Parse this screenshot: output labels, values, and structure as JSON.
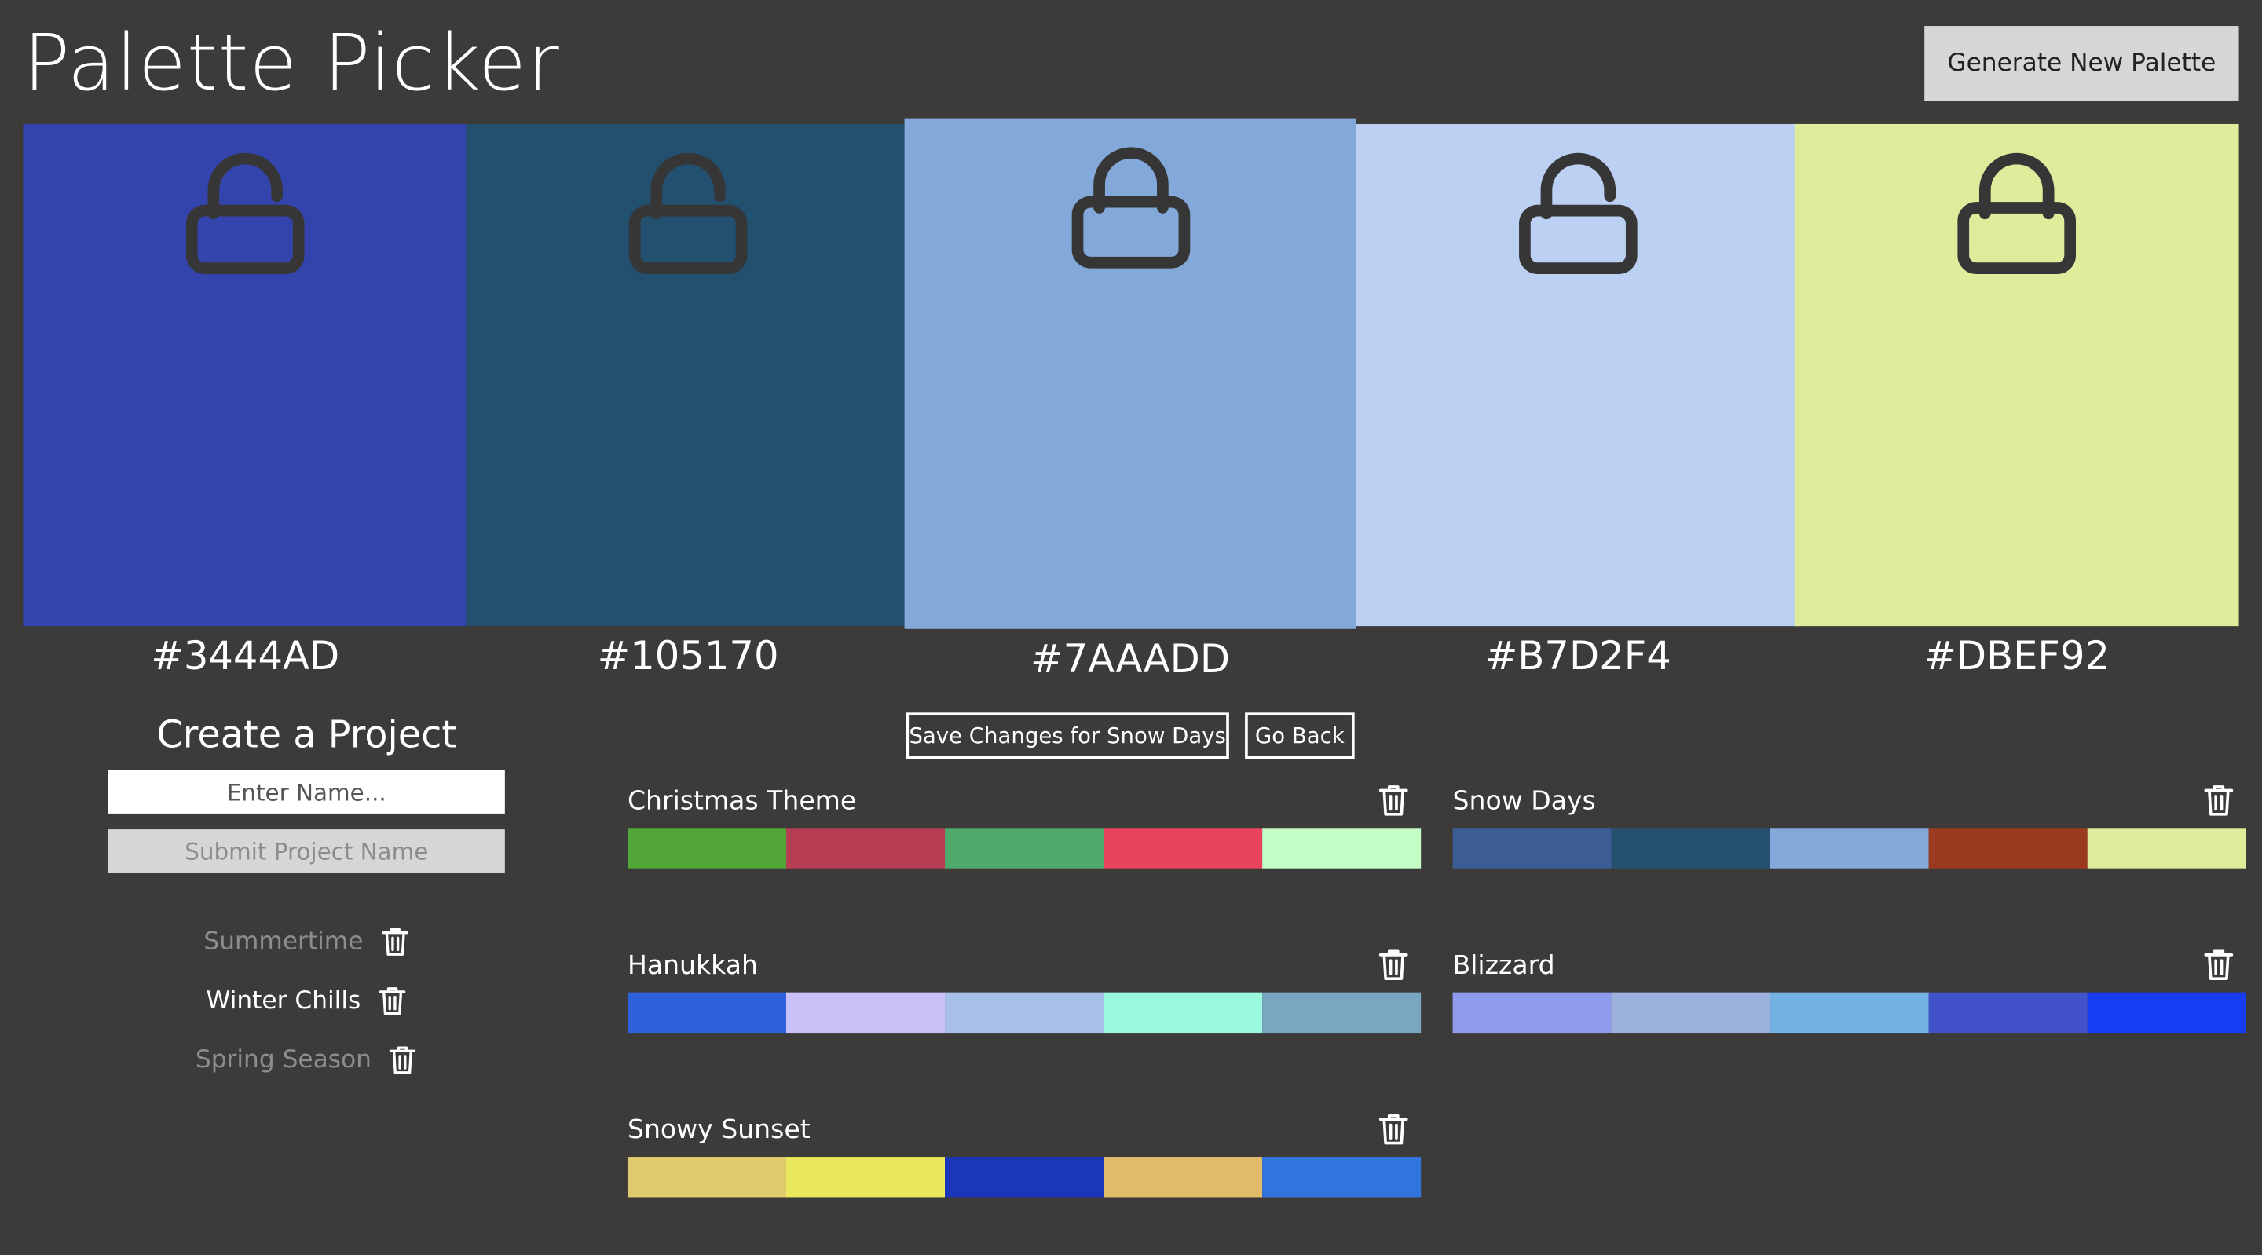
{
  "app": {
    "title": "Palette Picker",
    "generate_label": "Generate New Palette"
  },
  "swatches": [
    {
      "hex": "#3444AD",
      "color": "#3444AD",
      "locked": false
    },
    {
      "hex": "#105170",
      "color": "#24506F",
      "locked": false
    },
    {
      "hex": "#7AAADD",
      "color": "#82A9D9",
      "locked": true
    },
    {
      "hex": "#B7D2F4",
      "color": "#BBD0F2",
      "locked": false
    },
    {
      "hex": "#DBEF92",
      "color": "#DEEC9B",
      "locked": true
    }
  ],
  "create": {
    "title": "Create a Project",
    "name_placeholder": "Enter Name...",
    "submit_label": "Submit Project Name"
  },
  "projects": [
    {
      "name": "Summertime",
      "active": false
    },
    {
      "name": "Winter Chills",
      "active": true
    },
    {
      "name": "Spring Season",
      "active": false
    }
  ],
  "actions": {
    "save_label": "Save Changes for Snow Days",
    "back_label": "Go Back"
  },
  "palettes": [
    {
      "name": "Christmas Theme",
      "colors": [
        "#52A637",
        "#B63C53",
        "#4EA96B",
        "#E8425C",
        "#C4FDC5"
      ]
    },
    {
      "name": "Snow Days",
      "colors": [
        "#3C5D94",
        "#24506F",
        "#82A9D9",
        "#9C3A1F",
        "#DEEC9B"
      ]
    },
    {
      "name": "Hanukkah",
      "colors": [
        "#2E62DC",
        "#C8C0F6",
        "#A8C0E9",
        "#9AF8DD",
        "#79A7C2"
      ]
    },
    {
      "name": "Blizzard",
      "colors": [
        "#8E9AEB",
        "#9CB0DE",
        "#71B2E3",
        "#4252C8",
        "#173DF2"
      ]
    },
    {
      "name": "Snowy Sunset",
      "colors": [
        "#DFCA6D",
        "#E9E75C",
        "#1C36B9",
        "#E0BB68",
        "#3274DE"
      ]
    }
  ]
}
